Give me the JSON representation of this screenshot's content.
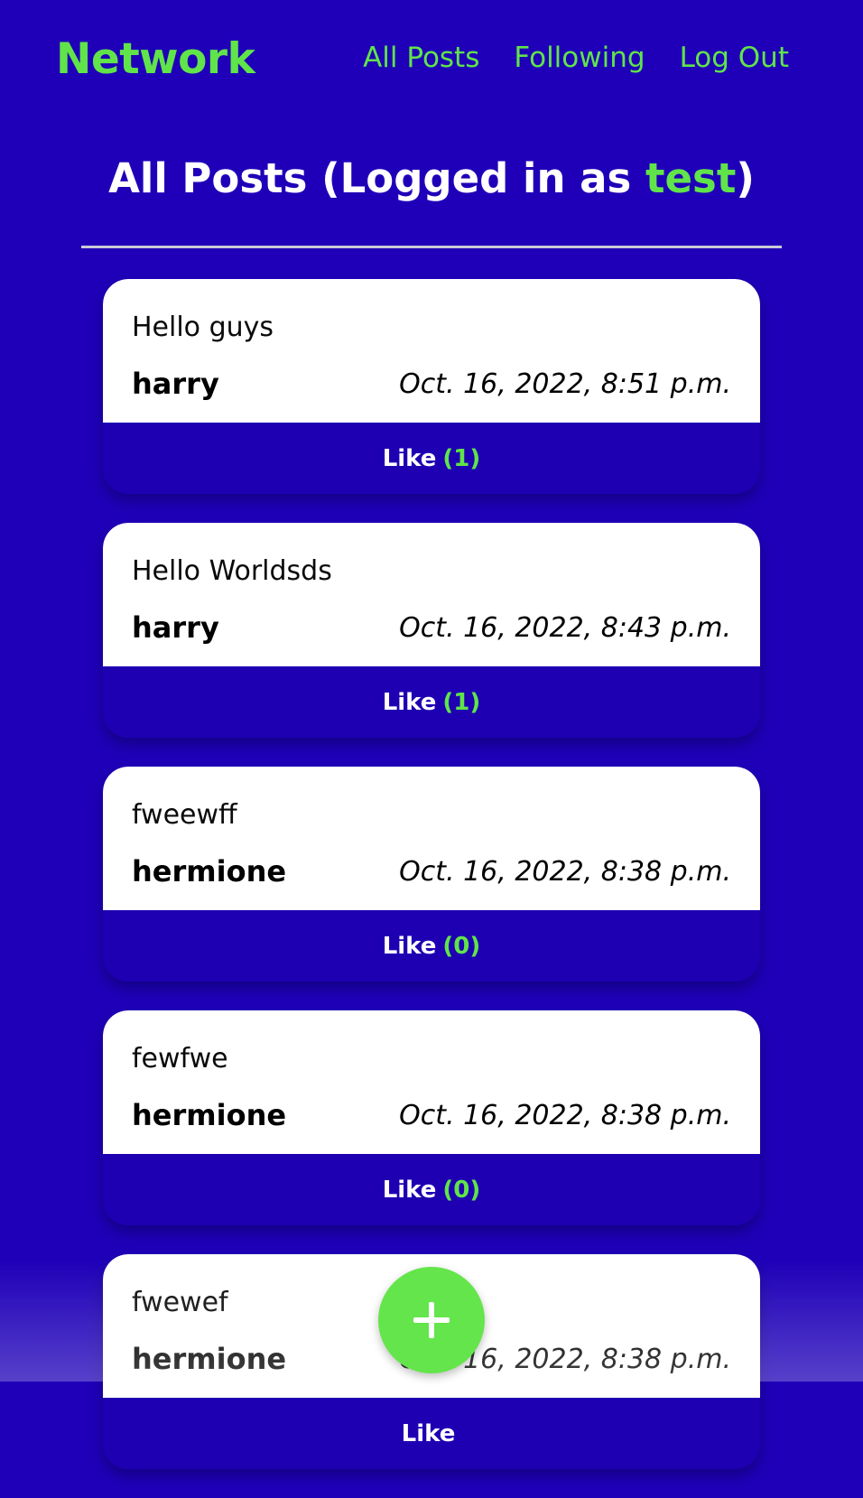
{
  "nav": {
    "brand": "Network",
    "links": [
      "All Posts",
      "Following",
      "Log Out"
    ]
  },
  "heading": {
    "prefix": "All Posts (Logged in as ",
    "username": "test",
    "suffix": ")"
  },
  "posts": [
    {
      "text": "Hello guys",
      "author": "harry",
      "timestamp": "Oct. 16, 2022, 8:51 p.m.",
      "like_label": "Like",
      "like_count": "(1)"
    },
    {
      "text": "Hello Worldsds",
      "author": "harry",
      "timestamp": "Oct. 16, 2022, 8:43 p.m.",
      "like_label": "Like",
      "like_count": "(1)"
    },
    {
      "text": "fweewff",
      "author": "hermione",
      "timestamp": "Oct. 16, 2022, 8:38 p.m.",
      "like_label": "Like",
      "like_count": "(0)"
    },
    {
      "text": "fewfwe",
      "author": "hermione",
      "timestamp": "Oct. 16, 2022, 8:38 p.m.",
      "like_label": "Like",
      "like_count": "(0)"
    },
    {
      "text": "fwewef",
      "author": "hermione",
      "timestamp": "Oct. 16, 2022, 8:38 p.m.",
      "like_label": "Like",
      "like_count": ""
    }
  ],
  "fab_icon": "plus-icon",
  "colors": {
    "background": "#1f00b8",
    "accent": "#60e44a",
    "card": "#ffffff",
    "text": "#000000"
  }
}
